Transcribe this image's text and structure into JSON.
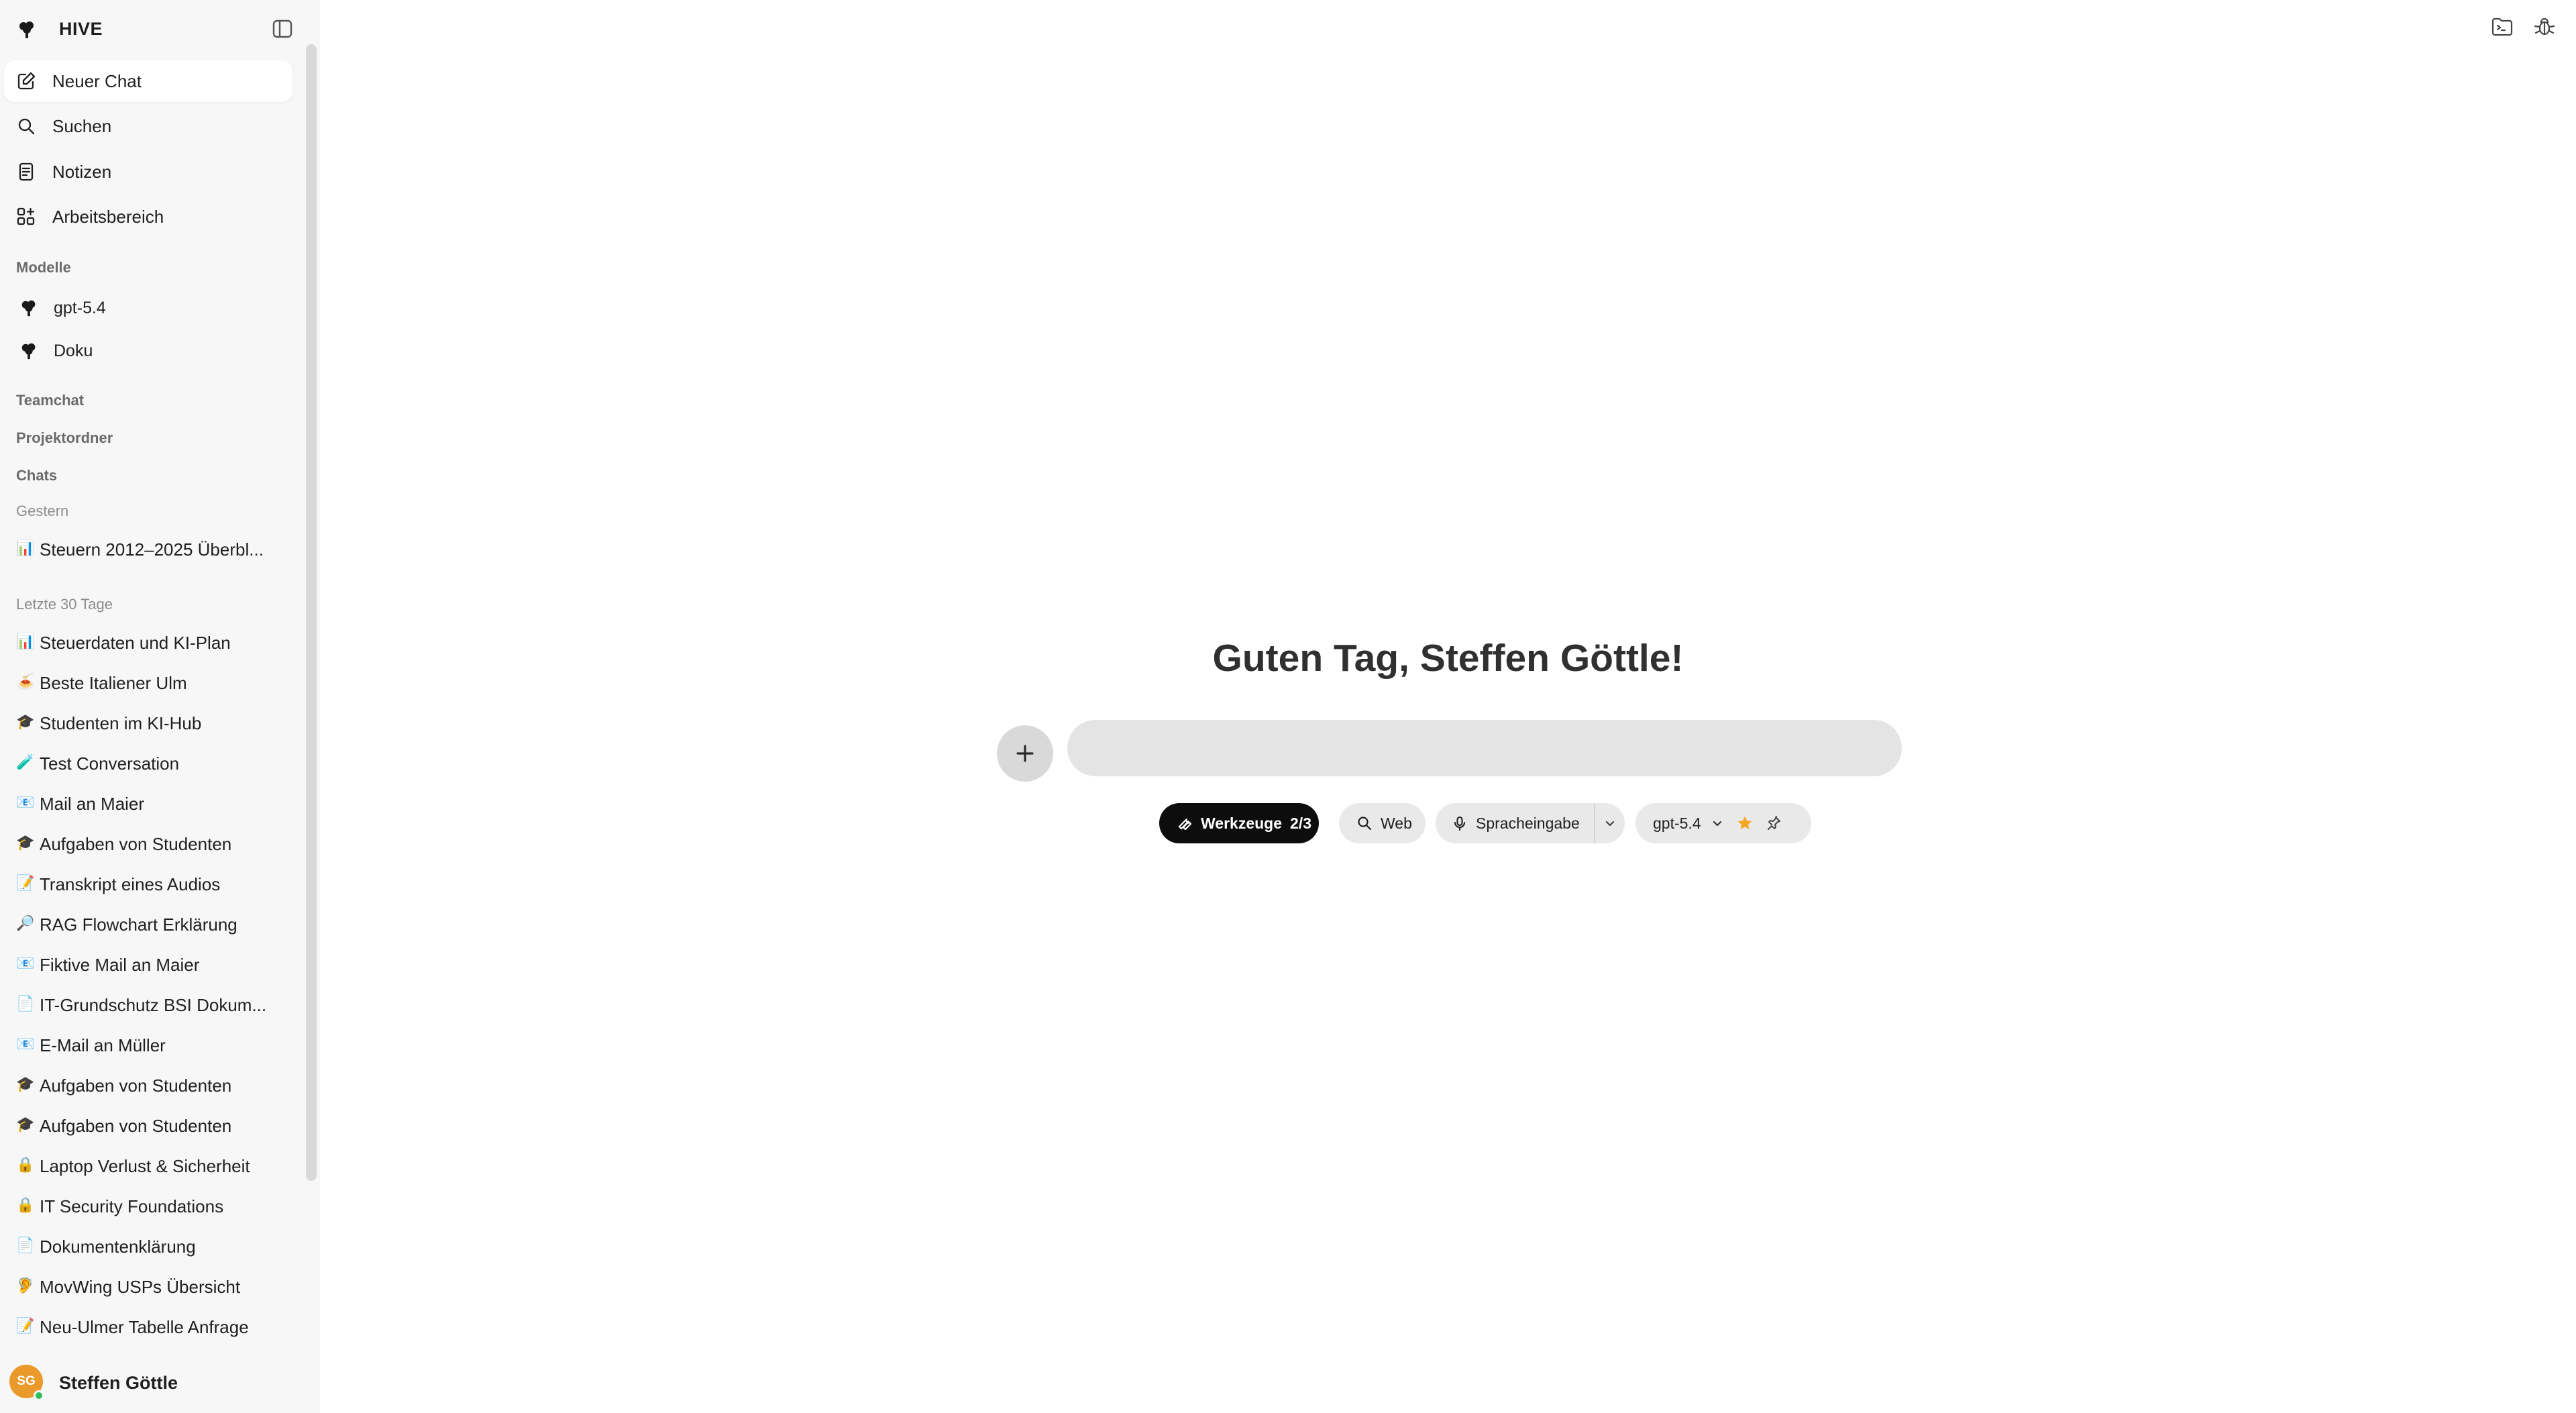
{
  "app": {
    "brand": "HIVE"
  },
  "nav": {
    "new_chat": "Neuer Chat",
    "search": "Suchen",
    "notes": "Notizen",
    "workspace": "Arbeitsbereich"
  },
  "sections": {
    "models": "Modelle",
    "teamchat": "Teamchat",
    "projects": "Projektordner",
    "chats": "Chats",
    "yesterday": "Gestern",
    "last30": "Letzte 30 Tage"
  },
  "models": [
    "gpt-5.4",
    "Doku"
  ],
  "chats_yesterday": [
    {
      "emoji": "📊",
      "title": "Steuern 2012–2025 Überbl..."
    }
  ],
  "chats_last30": [
    {
      "emoji": "📊",
      "title": "Steuerdaten und KI-Plan"
    },
    {
      "emoji": "🍝",
      "title": "Beste Italiener Ulm"
    },
    {
      "emoji": "🎓",
      "title": "Studenten im KI-Hub"
    },
    {
      "emoji": "🧪",
      "title": "Test Conversation"
    },
    {
      "emoji": "📧",
      "title": "Mail an Maier"
    },
    {
      "emoji": "🎓",
      "title": "Aufgaben von Studenten"
    },
    {
      "emoji": "📝",
      "title": "Transkript eines Audios"
    },
    {
      "emoji": "🔎",
      "title": "RAG Flowchart Erklärung"
    },
    {
      "emoji": "📧",
      "title": "Fiktive Mail an Maier"
    },
    {
      "emoji": "📄",
      "title": "IT-Grundschutz BSI Dokum..."
    },
    {
      "emoji": "📧",
      "title": "E-Mail an Müller"
    },
    {
      "emoji": "🎓",
      "title": "Aufgaben von Studenten"
    },
    {
      "emoji": "🎓",
      "title": "Aufgaben von Studenten"
    },
    {
      "emoji": "🔒",
      "title": "Laptop Verlust & Sicherheit"
    },
    {
      "emoji": "🔒",
      "title": "IT Security Foundations"
    },
    {
      "emoji": "📄",
      "title": "Dokumentenklärung"
    },
    {
      "emoji": "🦻",
      "title": "MovWing USPs Übersicht"
    },
    {
      "emoji": "📝",
      "title": "Neu-Ulmer Tabelle Anfrage"
    }
  ],
  "user": {
    "initials": "SG",
    "name": "Steffen Göttle"
  },
  "main": {
    "greeting": "Guten Tag, Steffen Göttle!",
    "input_value": "",
    "tools_label": "Werkzeuge",
    "tools_count": "2/3",
    "web_label": "Web",
    "voice_label": "Spracheingabe",
    "model_label": "gpt-5.4"
  },
  "colors": {
    "accent_star": "#f5a623",
    "avatar": "#ea9a2b",
    "online": "#2fbf5b"
  }
}
